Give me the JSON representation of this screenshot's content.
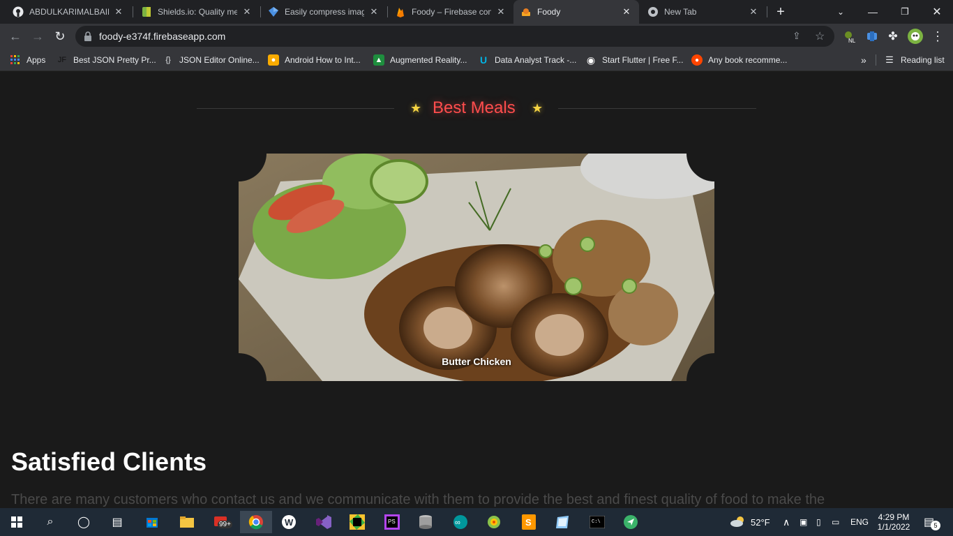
{
  "browser": {
    "tabs": [
      {
        "title": "ABDULKARIMALBAIK/",
        "icon": "github-icon"
      },
      {
        "title": "Shields.io: Quality met",
        "icon": "shields-icon"
      },
      {
        "title": "Easily compress image",
        "icon": "compress-icon"
      },
      {
        "title": "Foody – Firebase cons",
        "icon": "firebase-icon"
      },
      {
        "title": "Foody",
        "icon": "foody-icon"
      },
      {
        "title": "New Tab",
        "icon": "chrome-icon"
      }
    ],
    "url": "foody-e374f.firebaseapp.com",
    "bookmarks": [
      {
        "label": "Apps"
      },
      {
        "label": "Best JSON Pretty Pr..."
      },
      {
        "label": "JSON Editor Online..."
      },
      {
        "label": "Android How to Int..."
      },
      {
        "label": "Augmented Reality..."
      },
      {
        "label": "Data Analyst Track -..."
      },
      {
        "label": "Start Flutter | Free F..."
      },
      {
        "label": "Any book recomme..."
      }
    ],
    "reading_list": "Reading list",
    "more_bookmarks": "»"
  },
  "page": {
    "best_meals_title": "Best Meals",
    "meal_caption": "Butter Chicken",
    "clients_title": "Satisfied Clients",
    "clients_text": "There are many customers who contact us and we communicate with them to provide the best and finest quality of food to make the"
  },
  "taskbar": {
    "weather": "52°F",
    "lang": "ENG",
    "time": "4:29 PM",
    "date": "1/1/2022",
    "notif_count": "5",
    "mail_badge": "99+"
  },
  "colors": {
    "accent_red": "#ff4d4d",
    "star_yellow": "#f5d442",
    "page_bg": "#1a1a1a"
  }
}
